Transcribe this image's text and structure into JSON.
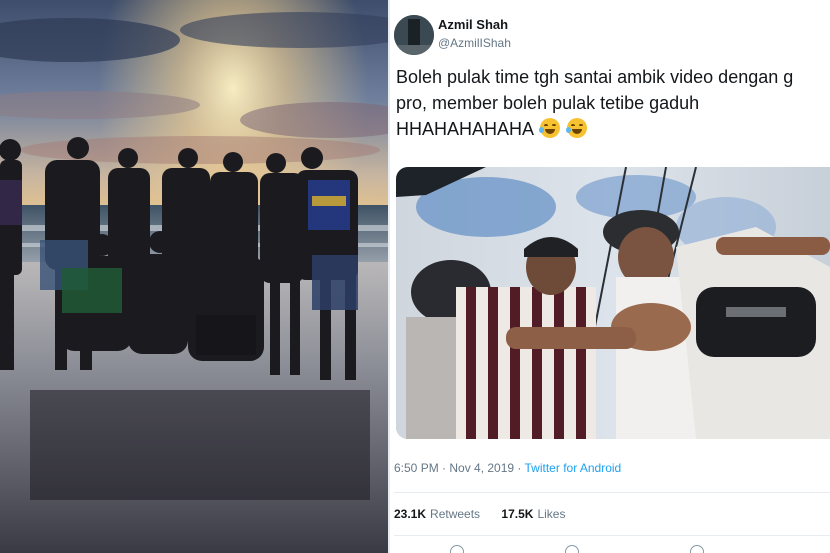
{
  "tweet": {
    "display_name": "Azmil Shah",
    "handle": "@AzmilIShah",
    "text_lines": [
      "Boleh pulak time tgh santai ambik video dengan g",
      "pro, member boleh pulak tetibe gaduh",
      "HHAHAHAHAHA"
    ],
    "emojis": [
      "face-with-tears-of-joy",
      "face-with-tears-of-joy"
    ],
    "timestamp": "6:50 PM · Nov 4, 2019 · ",
    "source": "Twitter for Android",
    "retweets_count": "23.1K",
    "retweets_label": "Retweets",
    "likes_count": "17.5K",
    "likes_label": "Likes"
  },
  "colors": {
    "accent": "#1da1f2",
    "text": "#14171a",
    "muted": "#657786"
  }
}
